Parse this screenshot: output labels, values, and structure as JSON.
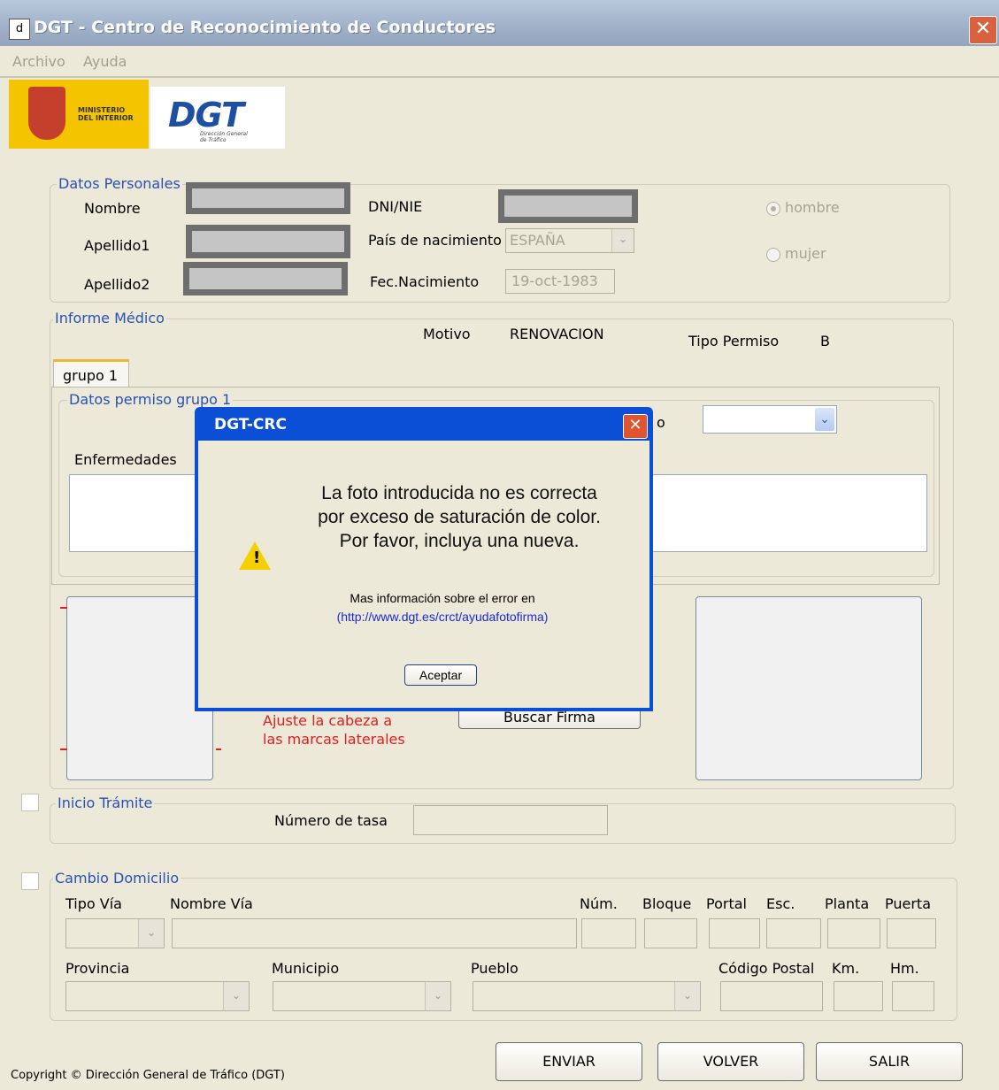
{
  "window": {
    "title": "DGT - Centro de Reconocimiento de Conductores",
    "close_glyph": "✕",
    "icon_glyph": "d"
  },
  "menu": [
    "Archivo",
    "Ayuda"
  ],
  "logos": {
    "ministerio": "MINISTERIO\nDEL INTERIOR",
    "dgt": "DGT",
    "dgt_sub": "Dirección General\nde Tráfico"
  },
  "personal": {
    "legend": "Datos Personales",
    "nombre_label": "Nombre",
    "apellido1_label": "Apellido1",
    "apellido2_label": "Apellido2",
    "dni_label": "DNI/NIE",
    "pais_label": "País de nacimiento",
    "pais_value": "ESPAÑA",
    "fecha_label": "Fec.Nacimiento",
    "fecha_value": "19-oct-1983",
    "hombre_label": "hombre",
    "mujer_label": "mujer",
    "selected_gender": "hombre"
  },
  "informe": {
    "legend": "Informe Médico",
    "motivo_label": "Motivo",
    "motivo_value": "RENOVACION",
    "tipo_label": "Tipo Permiso",
    "tipo_value": "B",
    "tab": "grupo 1",
    "datos_legend": "Datos permiso grupo 1",
    "enfermedades_label": "Enfermedades",
    "partial_label": "o",
    "photo_hint": "Ajuste la cabeza a\nlas marcas laterales",
    "buscar_firma": "Buscar Firma"
  },
  "inicio": {
    "legend": "Inicio Trámite",
    "tasa_label": "Número de tasa"
  },
  "domicilio": {
    "legend": "Cambio Domicilio",
    "tipo_via": "Tipo Vía",
    "nombre_via": "Nombre Vía",
    "num": "Núm.",
    "bloque": "Bloque",
    "portal": "Portal",
    "esc": "Esc.",
    "planta": "Planta",
    "puerta": "Puerta",
    "provincia": "Provincia",
    "municipio": "Municipio",
    "pueblo": "Pueblo",
    "codigo_postal": "Código Postal",
    "km": "Km.",
    "hm": "Hm."
  },
  "footer": {
    "copyright": "Copyright © Dirección General de Tráfico (DGT)",
    "enviar": "ENVIAR",
    "volver": "VOLVER",
    "salir": "SALIR"
  },
  "dialog": {
    "title": "DGT-CRC",
    "close_glyph": "✕",
    "icon": "warning-icon",
    "warn_glyph": "!",
    "line1": "La foto introducida no es correcta",
    "line2": "por exceso de saturación de color.",
    "line3": "Por favor, incluya una nueva.",
    "info": "Mas información sobre el error en",
    "link": "(http://www.dgt.es/crct/ayudafotofirma)",
    "ok": "Aceptar"
  },
  "colors": {
    "accent": "#0a4fd6",
    "legend": "#2a50b4",
    "hint": "#e02020",
    "link": "#1a2bd0"
  }
}
